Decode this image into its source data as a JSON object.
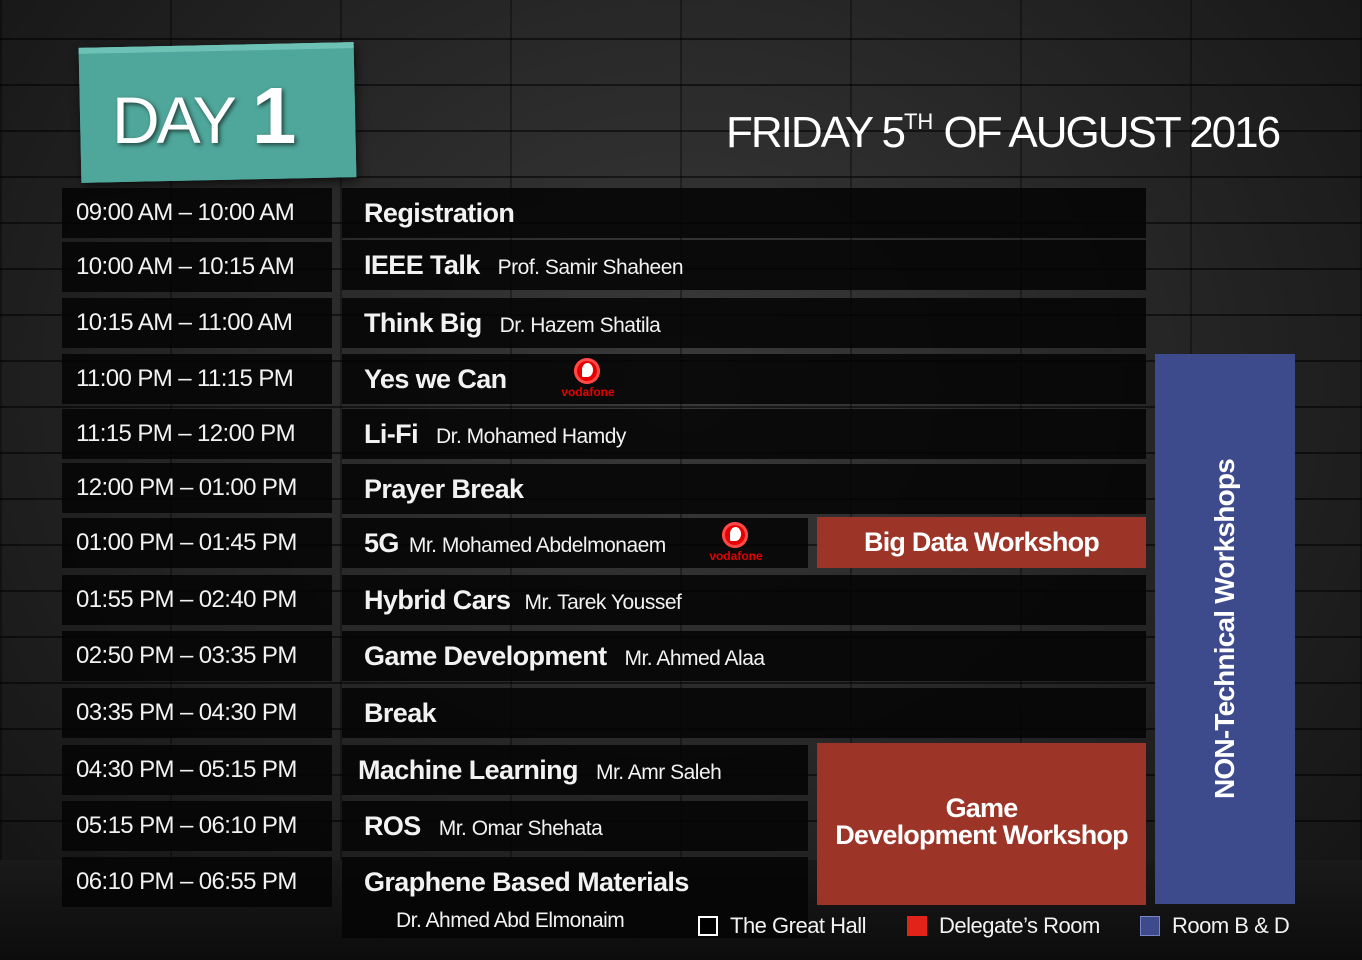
{
  "header": {
    "day_label": "DAY",
    "day_number": "1",
    "date_prefix": "FRIDAY 5",
    "date_ordinal": "TH",
    "date_suffix": " OF AUGUST 2016",
    "badge_color": "#4fa69a"
  },
  "schedule": [
    {
      "time": "09:00 AM – 10:00 AM",
      "title": "Registration",
      "speaker": ""
    },
    {
      "time": "10:00 AM – 10:15 AM",
      "title": "IEEE Talk",
      "speaker": "Prof. Samir Shaheen"
    },
    {
      "time": "10:15 AM – 11:00 AM",
      "title": "Think Big",
      "speaker": "Dr. Hazem Shatila"
    },
    {
      "time": "11:00 PM – 11:15 PM",
      "title": "Yes we Can",
      "speaker": "",
      "sponsor": "vodafone"
    },
    {
      "time": "11:15 PM – 12:00 PM",
      "title": "Li-Fi",
      "speaker": "Dr. Mohamed Hamdy"
    },
    {
      "time": "12:00 PM – 01:00 PM",
      "title": "Prayer Break",
      "speaker": ""
    },
    {
      "time": "01:00 PM – 01:45 PM",
      "title": "5G",
      "speaker": "Mr. Mohamed Abdelmonaem",
      "sponsor": "vodafone"
    },
    {
      "time": "01:55 PM – 02:40 PM",
      "title": "Hybrid Cars",
      "speaker": "Mr. Tarek Youssef"
    },
    {
      "time": "02:50 PM – 03:35 PM",
      "title": "Game Development",
      "speaker": "Mr. Ahmed Alaa"
    },
    {
      "time": "03:35 PM – 04:30 PM",
      "title": "Break",
      "speaker": ""
    },
    {
      "time": "04:30 PM – 05:15 PM",
      "title": "Machine Learning",
      "speaker": "Mr. Amr Saleh"
    },
    {
      "time": "05:15 PM – 06:10 PM",
      "title": "ROS",
      "speaker": "Mr. Omar Shehata"
    },
    {
      "time": "06:10 PM – 06:55 PM",
      "title": "Graphene Based Materials",
      "speaker": "Dr. Ahmed Abd Elmonaim"
    }
  ],
  "sponsor_logo_text": "vodafone",
  "workshops": {
    "big_data": "Big Data Workshop",
    "game_dev_line1": "Game",
    "game_dev_line2": "Development Workshop",
    "non_technical": "NON-Technical Workshops"
  },
  "legend": [
    {
      "label": "The Great Hall",
      "color": "#000000"
    },
    {
      "label": "Delegate’s Room",
      "color": "#e2231a"
    },
    {
      "label": "Room B & D",
      "color": "#3d4a8c"
    }
  ],
  "colors": {
    "workshop_red": "#9c3528",
    "workshop_blue": "#3d4a8c",
    "sponsor_red": "#e60000"
  }
}
